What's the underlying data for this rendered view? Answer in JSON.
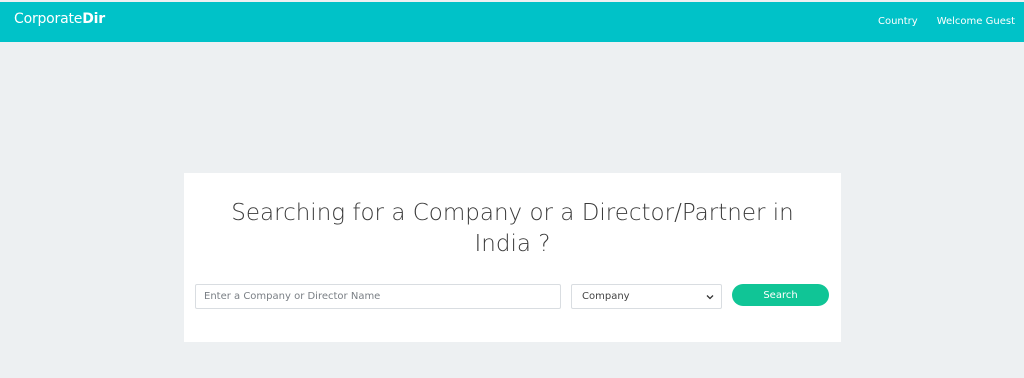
{
  "header": {
    "brand_part1": "Corporate",
    "brand_part2": "Dir",
    "nav": {
      "country": "Country",
      "welcome": "Welcome Guest"
    },
    "bg_color": "#00c2c8"
  },
  "search_card": {
    "heading_line1": "Searching for a Company or a Director/Partner in",
    "heading_line2": "India ?",
    "input_placeholder": "Enter a Company or Director Name",
    "input_value": "",
    "select_value": "Company",
    "search_button": "Search",
    "button_color": "#10c596"
  }
}
